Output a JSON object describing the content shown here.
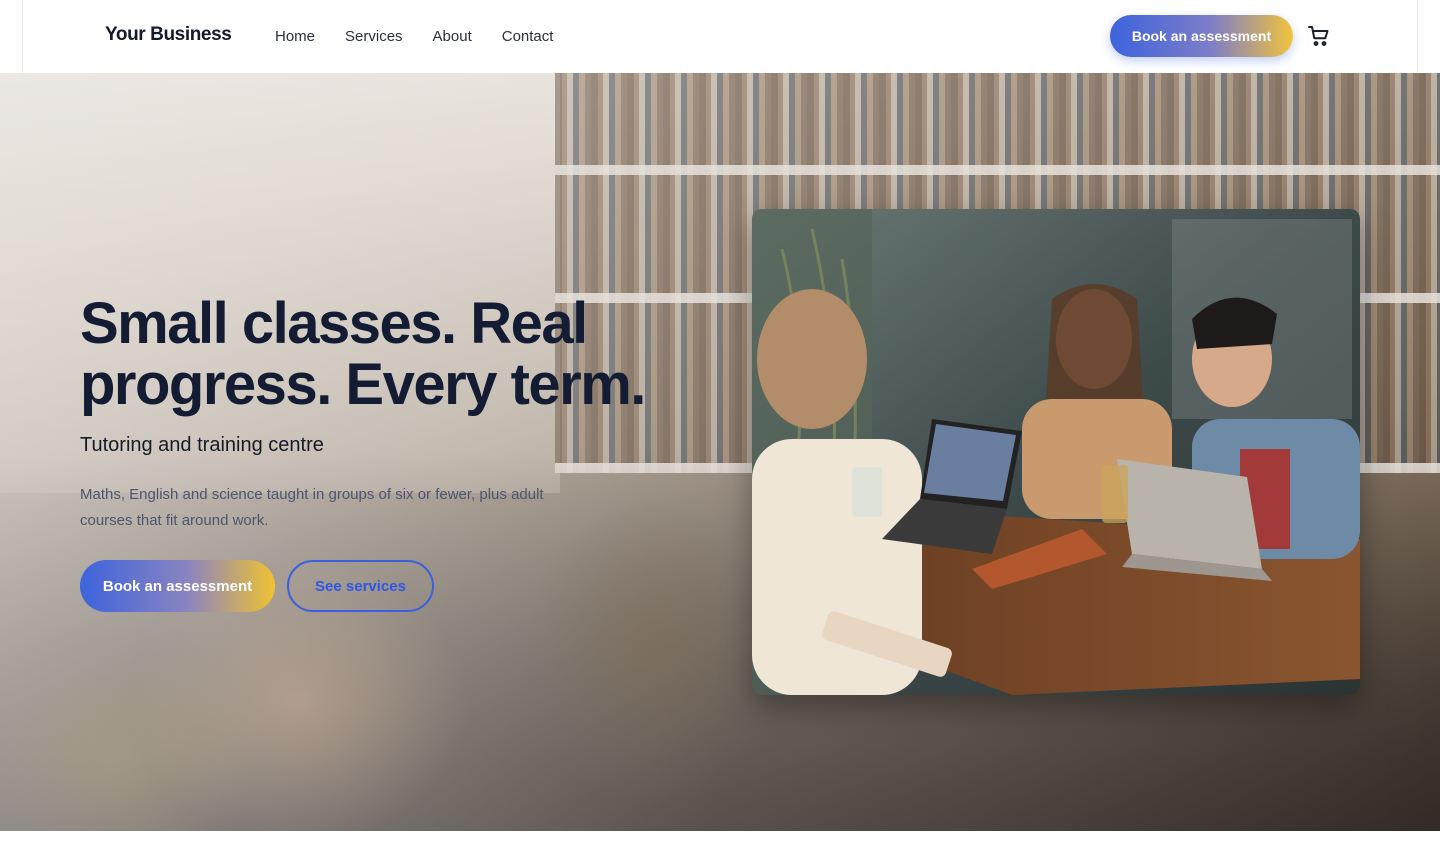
{
  "header": {
    "brand": "Your Business",
    "nav": [
      "Home",
      "Services",
      "About",
      "Contact"
    ],
    "cta_label": "Book an assessment",
    "cart_icon": "cart-icon"
  },
  "hero": {
    "title": "Small classes. Real progress. Every term.",
    "subtitle": "Tutoring and training centre",
    "description": "Maths, English and science taught in groups of six or fewer, plus adult courses that fit around work.",
    "primary_cta": "Book an assessment",
    "secondary_cta": "See services",
    "background_image": "students-laughing-library-photo",
    "feature_image": "three-people-laptops-table-photo"
  },
  "colors": {
    "title": "#141c33",
    "accent_blue": "#3d63dd",
    "accent_gold": "#f0c232",
    "link_blue": "#2f56e6"
  }
}
